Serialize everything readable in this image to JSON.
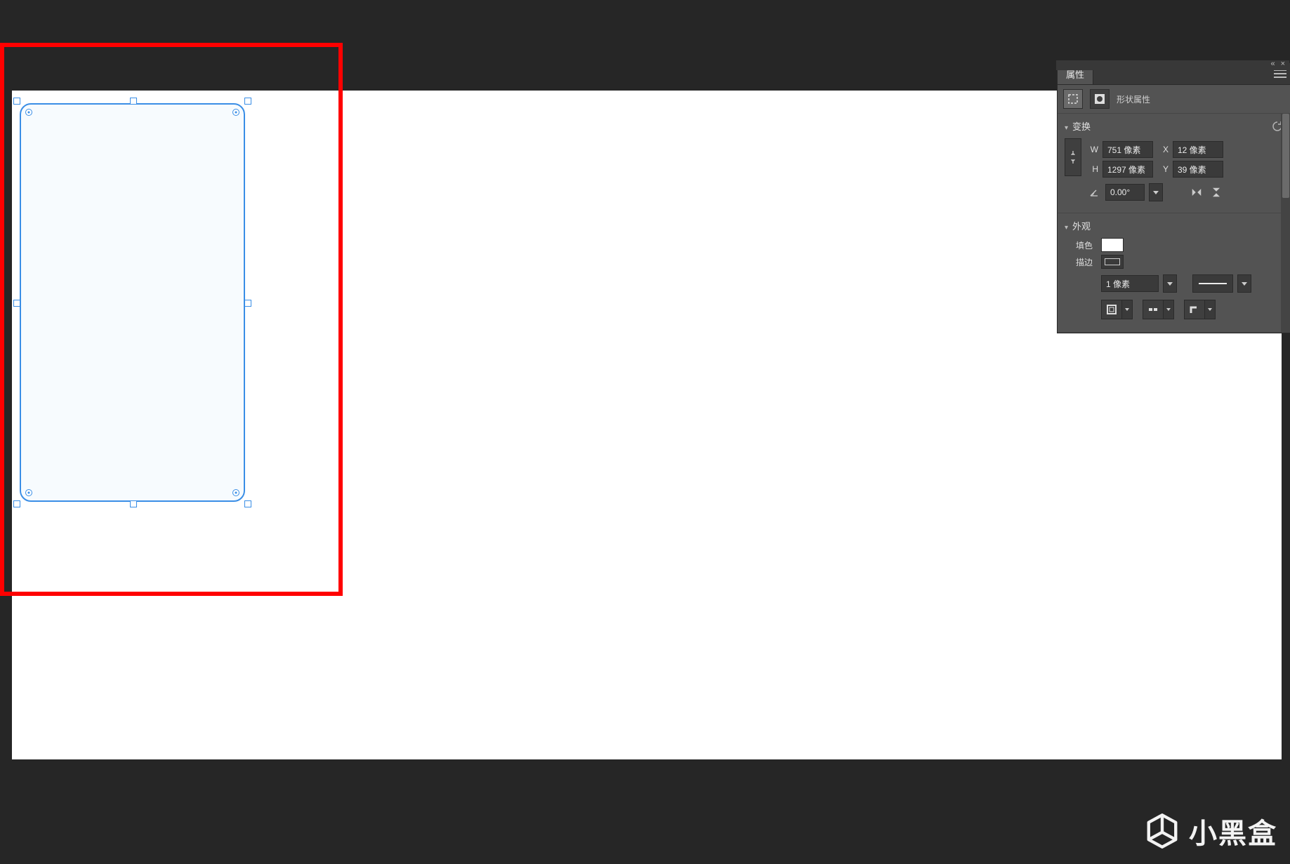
{
  "panel": {
    "tab_label": "属性",
    "subtitle": "形状属性",
    "sections": {
      "transform": {
        "title": "变换",
        "w_label": "W",
        "w_value": "751 像素",
        "h_label": "H",
        "h_value": "1297 像素",
        "x_label": "X",
        "x_value": "12 像素",
        "y_label": "Y",
        "y_value": "39 像素",
        "angle_value": "0.00°"
      },
      "appearance": {
        "title": "外观",
        "fill_label": "填色",
        "stroke_label": "描边",
        "stroke_weight": "1 像素"
      }
    }
  },
  "watermark": {
    "text": "小黑盒"
  }
}
